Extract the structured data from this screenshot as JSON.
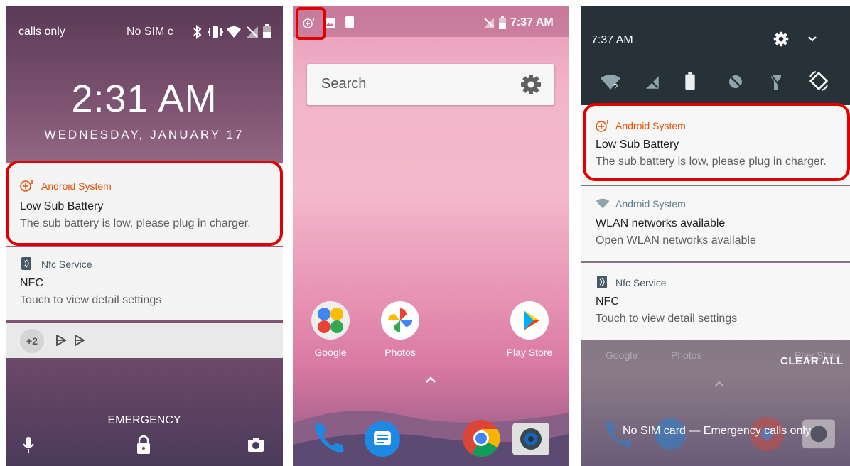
{
  "lock": {
    "status_left": "calls only",
    "status_mid": "No SIM c",
    "time": "2:31 AM",
    "date": "WEDNESDAY, JANUARY 17",
    "notifications": [
      {
        "app": "Android System",
        "title": "Low Sub Battery",
        "body": "The sub battery is low, please plug in charger.",
        "accent": "#e65100"
      },
      {
        "app": "Nfc Service",
        "title": "NFC",
        "body": "Touch to view detail settings",
        "accent": "#455a64"
      }
    ],
    "overflow_count": "+2",
    "emergency": "EMERGENCY"
  },
  "home": {
    "status_time": "7:37 AM",
    "search_label": "Search",
    "apps": [
      {
        "label": "Google",
        "icon": "google-folder-icon"
      },
      {
        "label": "Photos",
        "icon": "photos-icon"
      },
      {
        "label": "Play Store",
        "icon": "play-store-icon"
      }
    ],
    "dock": [
      "phone-icon",
      "messages-icon",
      "chrome-icon",
      "camera-icon"
    ]
  },
  "shade": {
    "time": "7:37 AM",
    "notifications": [
      {
        "app": "Android System",
        "title": "Low Sub Battery",
        "body": "The sub battery is low, please plug in charger.",
        "accent": "#e65100"
      },
      {
        "app": "Android System",
        "title": "WLAN networks available",
        "body": "Open WLAN networks available",
        "accent": "#90a4ae"
      },
      {
        "app": "Nfc Service",
        "title": "NFC",
        "body": "Touch to view detail settings",
        "accent": "#455a64"
      }
    ],
    "bg_labels": [
      "Google",
      "Photos",
      "Play Store"
    ],
    "clear_all": "CLEAR ALL",
    "footer": "No SIM card — Emergency calls only"
  },
  "colors": {
    "highlight": "#e00000",
    "accent_orange": "#e65100"
  }
}
